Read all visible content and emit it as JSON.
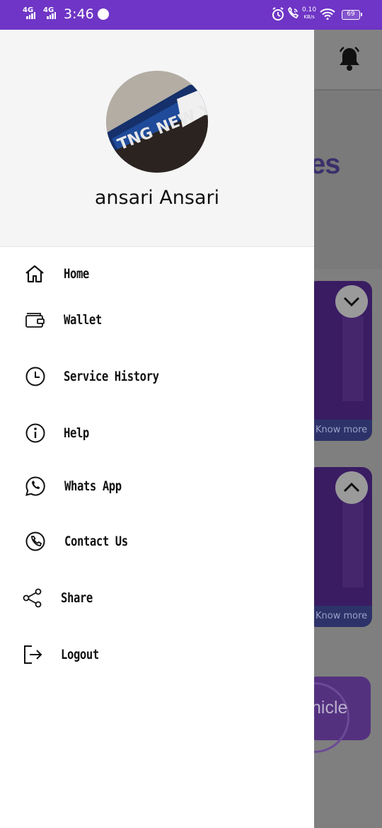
{
  "status_bar": {
    "network_1": "4G",
    "network_2": "4G",
    "time": "3:46",
    "speed_value": "0.10",
    "speed_unit": "KB/s",
    "battery": "69",
    "icons": [
      "signal-icon",
      "signal-icon",
      "circle-notification-icon",
      "alarm-icon",
      "volte-call-icon",
      "wifi-icon",
      "battery-icon"
    ]
  },
  "drawer": {
    "user_name": "ansari Ansari",
    "avatar_image_text": "TNG NEW YORK",
    "menu": [
      {
        "label": "Home",
        "icon": "home-icon"
      },
      {
        "label": "Wallet",
        "icon": "wallet-icon"
      },
      {
        "label": "Service History",
        "icon": "clock-icon"
      },
      {
        "label": "Help",
        "icon": "info-icon"
      },
      {
        "label": "Whats App",
        "icon": "whatsapp-icon"
      },
      {
        "label": "Contact Us",
        "icon": "phone-icon"
      },
      {
        "label": "Share",
        "icon": "share-icon"
      },
      {
        "label": "Logout",
        "icon": "logout-icon"
      }
    ]
  },
  "background_app": {
    "banner_text_fragment": "es",
    "card_1_link": "Know more",
    "card_2_link": "Know more",
    "vehicle_text_fragment": "hicle",
    "icons": [
      "bell-icon",
      "chevron-down-icon",
      "chevron-up-icon"
    ]
  },
  "colors": {
    "status_bar": "#6f35c6",
    "drawer_header": "#f5f5f5",
    "scrim": "#7f7f7f",
    "text": "#111111"
  }
}
